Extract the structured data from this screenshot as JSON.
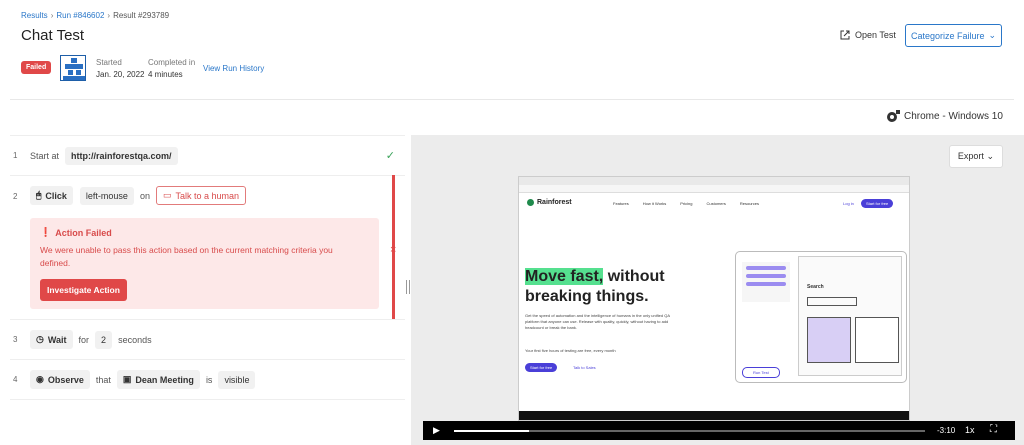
{
  "breadcrumb": {
    "results": "Results",
    "run": "Run #846602",
    "result": "Result #293789"
  },
  "page_title": "Chat Test",
  "status": "Failed",
  "started": {
    "label": "Started",
    "value": "Jan. 20, 2022"
  },
  "completed": {
    "label": "Completed in",
    "value": "4 minutes"
  },
  "view_history": "View Run History",
  "open_test": "Open Test",
  "categorize": "Categorize Failure",
  "browser": "Chrome - Windows 10",
  "export": "Export",
  "steps": [
    {
      "num": "1",
      "action": "Start at",
      "value": "http://rainforestqa.com/"
    },
    {
      "num": "2",
      "action": "Click",
      "target": "left-mouse",
      "word": "on",
      "element": "Talk to a human"
    },
    {
      "num": "3",
      "action": "Wait",
      "word": "for",
      "value": "2",
      "unit": "seconds"
    },
    {
      "num": "4",
      "action": "Observe",
      "word": "that",
      "element": "Dean Meeting",
      "word2": "is",
      "state": "visible"
    }
  ],
  "failure": {
    "title": "Action Failed",
    "message": "We were unable to pass this action based on the current matching criteria you defined.",
    "button": "Investigate Action"
  },
  "screenshot": {
    "nav": [
      "Features",
      "How it Works",
      "Pricing",
      "Customers",
      "Resources"
    ],
    "login": "Log in",
    "cta": "Start for free",
    "headline_hl": "Move fast,",
    "headline_1": " without",
    "headline_2": "breaking things.",
    "body": "Get the speed of automation and the intelligence of humans in the only unified QA platform that anyone can use. Release with quality, quickly, without having to add headcount or break the bank.",
    "small": "Your first five hours of testing are free, every month",
    "cta2": "Start for free",
    "sales": "Talk to Sales",
    "card_search": "Search",
    "card_run": "Run Test",
    "logo": "Rainforest"
  },
  "player": {
    "time": "-3:10",
    "speed": "1x",
    "progress": 0.16
  }
}
